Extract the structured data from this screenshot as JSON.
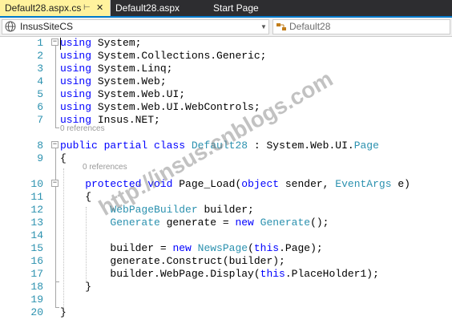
{
  "tabs": [
    {
      "label": "Default28.aspx.cs",
      "active": true
    },
    {
      "label": "Default28.aspx",
      "active": false
    },
    {
      "label": "Start Page",
      "active": false
    }
  ],
  "nav": {
    "project": "InsusSiteCS",
    "member": "Default28"
  },
  "codelens": {
    "line7": "0 references",
    "line9": "0 references"
  },
  "lines": [
    {
      "n": "1",
      "tokens": [
        [
          "k",
          "using"
        ],
        [
          "",
          "System;"
        ]
      ]
    },
    {
      "n": "2",
      "tokens": [
        [
          "k",
          "using"
        ],
        [
          "",
          "System.Collections.Generic;"
        ]
      ]
    },
    {
      "n": "3",
      "tokens": [
        [
          "k",
          "using"
        ],
        [
          "",
          "System.Linq;"
        ]
      ]
    },
    {
      "n": "4",
      "tokens": [
        [
          "k",
          "using"
        ],
        [
          "",
          "System.Web;"
        ]
      ]
    },
    {
      "n": "5",
      "tokens": [
        [
          "k",
          "using"
        ],
        [
          "",
          "System.Web.UI;"
        ]
      ]
    },
    {
      "n": "6",
      "tokens": [
        [
          "k",
          "using"
        ],
        [
          "",
          "System.Web.UI.WebControls;"
        ]
      ]
    },
    {
      "n": "7",
      "tokens": [
        [
          "k",
          "using"
        ],
        [
          "",
          "Insus.NET;"
        ]
      ]
    },
    {
      "n": "8",
      "tokens": [
        [
          "k",
          "public partial class"
        ],
        [
          "t",
          "Default28"
        ],
        [
          "",
          " : System.Web.UI."
        ],
        [
          "t",
          "Page"
        ]
      ]
    },
    {
      "n": "9",
      "tokens": [
        [
          "",
          "{"
        ]
      ]
    },
    {
      "n": "10",
      "tokens": [
        [
          "k",
          "    protected void"
        ],
        [
          "",
          " Page_Load("
        ],
        [
          "k",
          "object"
        ],
        [
          "",
          " sender, "
        ],
        [
          "t",
          "EventArgs"
        ],
        [
          "",
          " e)"
        ]
      ]
    },
    {
      "n": "11",
      "tokens": [
        [
          "",
          "    {"
        ]
      ]
    },
    {
      "n": "12",
      "tokens": [
        [
          "t",
          "        WebPageBuilder"
        ],
        [
          "",
          " builder;"
        ]
      ]
    },
    {
      "n": "13",
      "tokens": [
        [
          "t",
          "        Generate"
        ],
        [
          "",
          " generate = "
        ],
        [
          "k",
          "new"
        ],
        [
          "t",
          " Generate"
        ],
        [
          "",
          "();"
        ]
      ]
    },
    {
      "n": "14",
      "tokens": []
    },
    {
      "n": "15",
      "tokens": [
        [
          "",
          "        builder = "
        ],
        [
          "k",
          "new"
        ],
        [
          "t",
          " NewsPage"
        ],
        [
          "",
          "("
        ],
        [
          "k",
          "this"
        ],
        [
          "",
          ".Page);"
        ]
      ]
    },
    {
      "n": "16",
      "tokens": [
        [
          "",
          "        generate.Construct(builder);"
        ]
      ]
    },
    {
      "n": "17",
      "tokens": [
        [
          "",
          "        builder.WebPage.Display("
        ],
        [
          "k",
          "this"
        ],
        [
          "",
          ".PlaceHolder1);"
        ]
      ]
    },
    {
      "n": "18",
      "tokens": [
        [
          "",
          "    }"
        ]
      ]
    },
    {
      "n": "19",
      "tokens": []
    },
    {
      "n": "20",
      "tokens": [
        [
          "",
          "}"
        ]
      ]
    }
  ],
  "watermark": "http://insus.cnblogs.com",
  "colors": {
    "keyword": "#0000ff",
    "type": "#2b91af",
    "line_number": "#2b91af",
    "active_tab": "#fff29d",
    "tab_strip": "#2d2d30"
  }
}
